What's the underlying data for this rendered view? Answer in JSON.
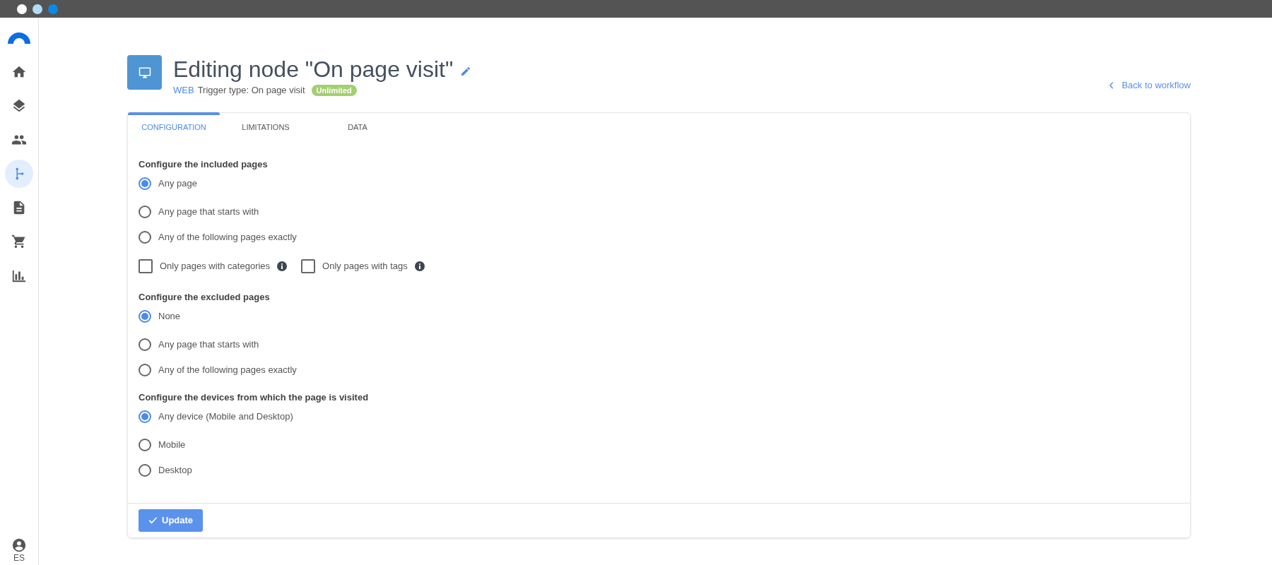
{
  "window": {
    "controls": [
      {
        "color": "#ffffff"
      },
      {
        "color": "#b3dcf8"
      },
      {
        "color": "#0a8ae6"
      }
    ]
  },
  "sidebar": {
    "items": [
      {
        "kind": "home",
        "selected": false
      },
      {
        "kind": "layers",
        "selected": false
      },
      {
        "kind": "people",
        "selected": false
      },
      {
        "kind": "branch",
        "selected": true
      },
      {
        "kind": "document",
        "selected": false
      },
      {
        "kind": "cart",
        "selected": false
      },
      {
        "kind": "chart",
        "selected": false
      }
    ],
    "user": {
      "label": "ES"
    }
  },
  "header": {
    "title": "Editing node \"On page visit\"",
    "channel": "WEB",
    "trigger": "Trigger type: On page visit",
    "badge": "Unlimited",
    "back_link": "Back to workflow"
  },
  "tabs": [
    {
      "label": "CONFIGURATION",
      "selected": true
    },
    {
      "label": "LIMITATIONS",
      "selected": false
    },
    {
      "label": "DATA",
      "selected": false
    }
  ],
  "sections": [
    {
      "heading": "Configure the included pages",
      "options": [
        {
          "label": "Any page",
          "selected": true
        },
        {
          "label": "Any page that starts with",
          "selected": false
        },
        {
          "label": "Any of the following pages exactly",
          "selected": false
        }
      ],
      "filters": [
        {
          "label": "Only pages with categories",
          "checked": false
        },
        {
          "label": "Only pages with tags",
          "checked": false
        }
      ]
    },
    {
      "heading": "Configure the excluded pages",
      "options": [
        {
          "label": "None",
          "selected": true
        },
        {
          "label": "Any page that starts with",
          "selected": false
        },
        {
          "label": "Any of the following pages exactly",
          "selected": false
        }
      ]
    },
    {
      "heading": "Configure the devices from which the page is visited",
      "options": [
        {
          "label": "Any device (Mobile and Desktop)",
          "selected": true
        },
        {
          "label": "Mobile",
          "selected": false
        },
        {
          "label": "Desktop",
          "selected": false
        }
      ]
    }
  ],
  "submit": {
    "label": "Update"
  }
}
